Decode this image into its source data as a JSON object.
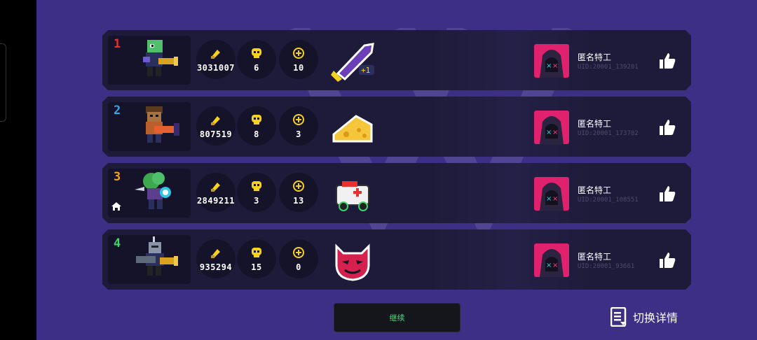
{
  "players": [
    {
      "rank": "1",
      "rank_color": "#e8312f",
      "ammo": "3031007",
      "kills": "6",
      "coins": "10",
      "name": "匿名特工",
      "uid": "UID:20001_139201",
      "hero": "green-lizard-gunner",
      "item": "shark-missile-plus1",
      "home": false
    },
    {
      "rank": "2",
      "rank_color": "#2fa7e8",
      "ammo": "807519",
      "kills": "8",
      "coins": "3",
      "name": "匿名特工",
      "uid": "UID:20001_173702",
      "hero": "brown-bear-gunner",
      "item": "cheese-wedge",
      "home": false
    },
    {
      "rank": "3",
      "rank_color": "#f0a21c",
      "ammo": "2849211",
      "kills": "3",
      "coins": "13",
      "name": "匿名特工",
      "uid": "UID:20001_108551",
      "hero": "druid-tree-mage",
      "item": "ambulance-car",
      "home": true
    },
    {
      "rank": "4",
      "rank_color": "#3fd46a",
      "ammo": "935294",
      "kills": "15",
      "coins": "0",
      "name": "匿名特工",
      "uid": "UID:20001_93661",
      "hero": "knight-gunner",
      "item": "red-devil-mask",
      "home": false
    }
  ],
  "continue_label": "继续",
  "switch_label": "切换详情",
  "colors": {
    "background": "#3d2f86",
    "row": "#1e1b3a",
    "avatar": "#e0216e",
    "accent_yellow": "#f5d21e"
  }
}
